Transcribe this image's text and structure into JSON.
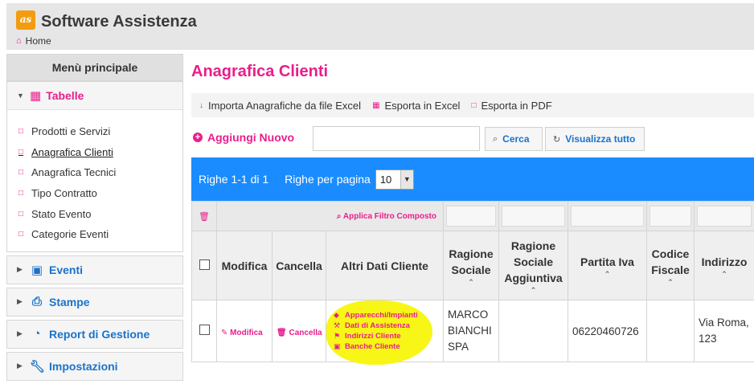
{
  "app": {
    "logo_text": "as",
    "title": "Software Assistenza",
    "breadcrumb": "Home"
  },
  "sidebar": {
    "title": "Menù principale",
    "groups": [
      {
        "label": "Tabelle",
        "icon": "table-icon",
        "expanded": true,
        "items": [
          {
            "label": "Prodotti e Servizi"
          },
          {
            "label": "Anagrafica Clienti",
            "current": true
          },
          {
            "label": "Anagrafica Tecnici"
          },
          {
            "label": "Tipo Contratto"
          },
          {
            "label": "Stato Evento"
          },
          {
            "label": "Categorie Eventi"
          }
        ]
      },
      {
        "label": "Eventi",
        "icon": "calendar-icon"
      },
      {
        "label": "Stampe",
        "icon": "printer-icon"
      },
      {
        "label": "Report di Gestione",
        "icon": "pie-chart-icon"
      },
      {
        "label": "Impostazioni",
        "icon": "wrench-icon"
      }
    ]
  },
  "main": {
    "title": "Anagrafica Clienti",
    "toolbar": {
      "import": "Importa Anagrafiche da file Excel",
      "excel": "Esporta in Excel",
      "pdf": "Esporta in PDF"
    },
    "add_new": "Aggiungi Nuovo",
    "search": {
      "value": "",
      "placeholder": ""
    },
    "search_button": "Cerca",
    "show_all_button": "Visualizza tutto",
    "pager": {
      "rows_info": "Righe 1-1 di 1",
      "per_page_label": "Righe per pagina",
      "per_page_value": "10"
    },
    "filter_link": "Applica Filtro Composto",
    "columns": [
      "Modifica",
      "Cancella",
      "Altri Dati Cliente",
      "Ragione Sociale",
      "Ragione Sociale Aggiuntiva",
      "Partita Iva",
      "Codice Fiscale",
      "Indirizzo"
    ],
    "rows": [
      {
        "modifica": "Modifica",
        "cancella": "Cancella",
        "altri": [
          "Apparecchi/Impianti",
          "Dati di Assistenza",
          "Indirizzi Cliente",
          "Banche Cliente"
        ],
        "ragione_sociale": "MARCO BIANCHI SPA",
        "ragione_aggiuntiva": "",
        "partita_iva": "06220460726",
        "codice_fiscale": "",
        "indirizzo": "Via Roma, 123"
      }
    ]
  },
  "colors": {
    "accent": "#e91e8c",
    "link_blue": "#1a73c9",
    "pager_blue": "#1a8cff",
    "highlight": "#f7f50a"
  }
}
